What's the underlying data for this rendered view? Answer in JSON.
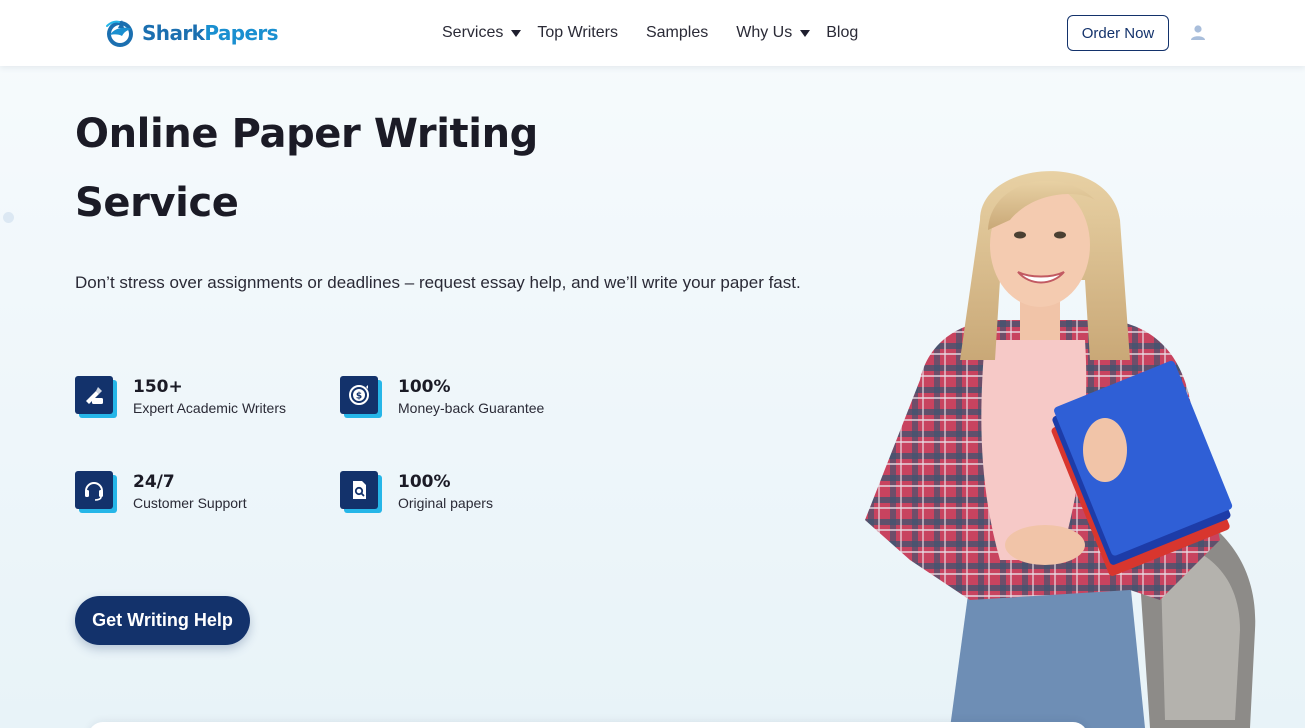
{
  "header": {
    "logo": {
      "part1": "Shark",
      "part2": "Papers"
    },
    "nav": [
      {
        "label": "Services",
        "dropdown": true
      },
      {
        "label": "Top Writers",
        "dropdown": false
      },
      {
        "label": "Samples",
        "dropdown": false
      },
      {
        "label": "Why Us",
        "dropdown": true
      },
      {
        "label": "Blog",
        "dropdown": false
      }
    ],
    "order_button": "Order Now",
    "user_icon": "user-icon"
  },
  "hero": {
    "title_line1": "Online Paper Writing",
    "title_line2": "Service",
    "subtitle": "Don’t stress over assignments or deadlines – request essay help, and we’ll write your paper fast.",
    "stats": [
      {
        "value": "150+",
        "label": "Expert Academic Writers",
        "icon": "writer-hand-icon"
      },
      {
        "value": "100%",
        "label": "Money-back Guarantee",
        "icon": "money-back-icon"
      },
      {
        "value": "24/7",
        "label": "Customer Support",
        "icon": "headset-icon"
      },
      {
        "value": "100%",
        "label": "Original papers",
        "icon": "document-search-icon"
      }
    ],
    "cta": "Get Writing Help"
  },
  "colors": {
    "navy": "#13326b",
    "accent_cyan": "#26b6e8",
    "logo_blue": "#1a8fd0",
    "background": "#f3f9fc"
  }
}
